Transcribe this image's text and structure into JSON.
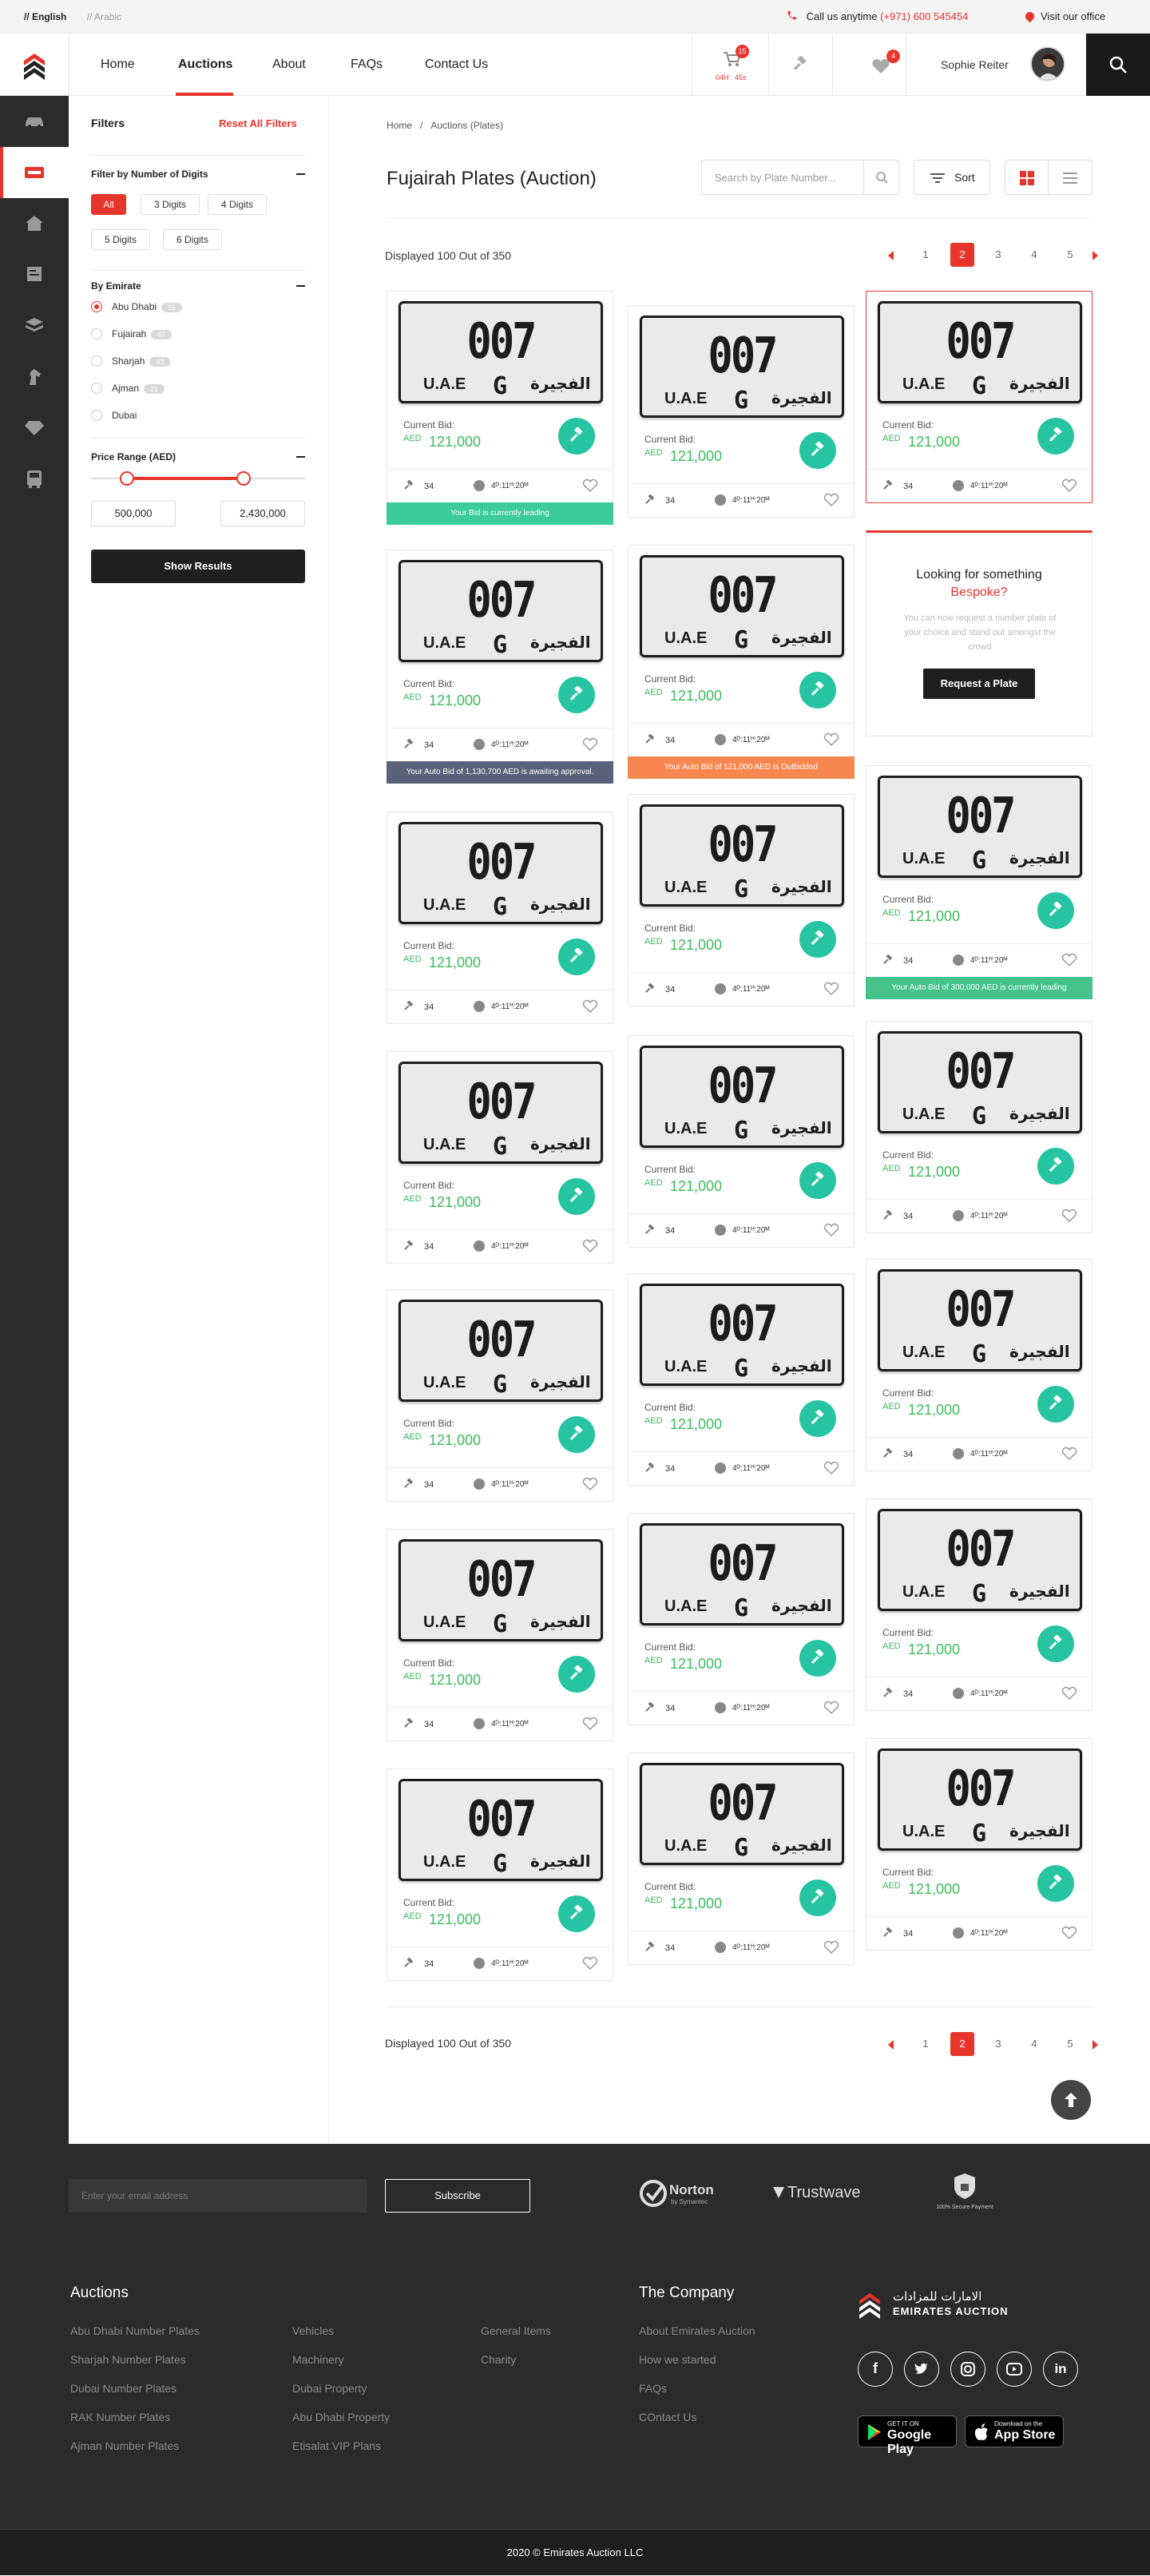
{
  "topbar": {
    "lang_en": "// English",
    "lang_ar": "// Arabic",
    "call_label": "Call us anytime",
    "call_number": "(+971) 600 545454",
    "visit": "Visit our office"
  },
  "nav": {
    "items": [
      "Home",
      "Auctions",
      "About",
      "FAQs",
      "Contact Us"
    ],
    "active": "Auctions"
  },
  "header": {
    "cart_count": "15",
    "cart_timer": "04H : 45s",
    "watch_count": "4",
    "user_name": "Sophie Reiter"
  },
  "sidebar_icons": [
    "car-icon",
    "plate-icon",
    "home-icon",
    "document-icon",
    "stack-icon",
    "horse-icon",
    "diamond-icon",
    "bus-icon"
  ],
  "filters": {
    "title": "Filters",
    "reset": "Reset All Filters",
    "digits_title": "Filter by Number of Digits",
    "digits": [
      "All",
      "3 Digits",
      "4 Digits",
      "5 Digits",
      "6 Digits"
    ],
    "emirate_title": "By Emirate",
    "emirates": [
      {
        "name": "Abu Dhabi",
        "count": "55"
      },
      {
        "name": "Fujairah",
        "count": "67"
      },
      {
        "name": "Sharjah",
        "count": "43"
      },
      {
        "name": "Ajman",
        "count": "21"
      },
      {
        "name": "Dubai",
        "count": ""
      }
    ],
    "price_title": "Price Range (AED)",
    "min": "500,000",
    "max": "2,430,000",
    "show": "Show Results"
  },
  "main": {
    "crumb": [
      "Home",
      "/",
      "Auctions (Plates)"
    ],
    "title": "Fujairah Plates (Auction)",
    "search_placeholder": "Search by Plate Number...",
    "sort": "Sort",
    "displayed": "Displayed 100 Out of 350",
    "pages": [
      "1",
      "2",
      "3",
      "4",
      "5"
    ],
    "current_page": "2"
  },
  "card": {
    "number": "007",
    "uae": "U.A.E",
    "letter": "G",
    "emirate_ar": "الفجيرة",
    "current_bid": "Current Bid:",
    "aed": "AED",
    "price": "121,000",
    "bids": "34",
    "time": "4ᴰ:11ᴴ:20ᴹ"
  },
  "banners": {
    "leading": "Your Bid is currently leading",
    "awaiting": "Your Auto Bid of 1,130,700 AED is awaiting approval.",
    "outbid": "Your Auto Bid of 121,000 AED is Outbidded",
    "auto_leading": "Your Auto Bid of 300,000 AED is currently leading"
  },
  "bespoke": {
    "line1": "Looking for something",
    "line2": "Bespoke?",
    "desc": "You can now request a number plate of your choice and stand out amongst the crowd",
    "button": "Request a Plate"
  },
  "footer": {
    "email_placeholder": "Enter your email address",
    "subscribe": "Subscribe",
    "trust": [
      "Norton",
      "by Symantec",
      "Trustwave",
      "100% Secure Payment"
    ],
    "auctions_title": "Auctions",
    "col1": [
      "Abu Dhabi Number Plates",
      "Sharjah Number Plates",
      "Dubai Number Plates",
      "RAK Number Plates",
      "Ajman Number Plates"
    ],
    "col2": [
      "Vehicles",
      "Machinery",
      "Dubai Property",
      "Abu Dhabi Property",
      "Etisalat VIP Plans"
    ],
    "col3": [
      "General Items",
      "Charity"
    ],
    "company_title": "The Company",
    "company": [
      "About Emirates Auction",
      "How we started",
      "FAQs",
      "COntact Us"
    ],
    "brand_ar": "الامارات للمزادات",
    "brand_en": "EMIRATES AUCTION",
    "social": [
      "facebook-icon",
      "twitter-icon",
      "instagram-icon",
      "youtube-icon",
      "linkedin-icon"
    ],
    "google_small": "GET IT ON",
    "google_big": "Google Play",
    "apple_small": "Download on the",
    "apple_big": "App Store",
    "copyright": "2020 © Emirates Auction LLC"
  },
  "colors": {
    "accent": "#e8352c",
    "green": "#3dba5d",
    "bid_button": "#26c4a2",
    "banner_leading": "#3ccb9a",
    "banner_awaiting": "#5b6178",
    "banner_outbid": "#f7874f",
    "banner_auto": "#45c38b"
  }
}
